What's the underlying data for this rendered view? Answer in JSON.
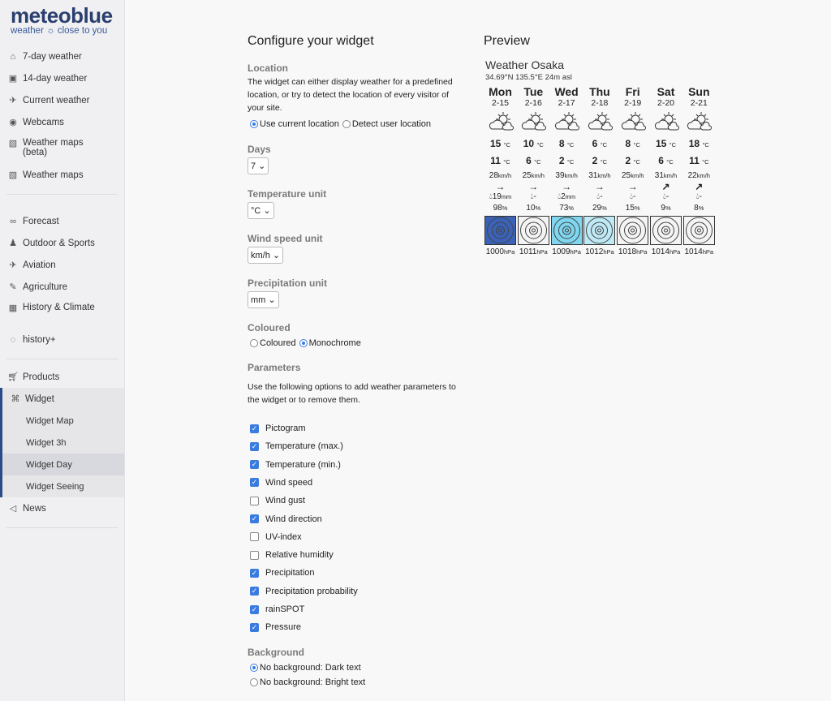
{
  "brand": {
    "name": "meteoblue",
    "tagline": "weather ☼ close to you"
  },
  "sidebar": {
    "group1": [
      {
        "label": "7-day weather",
        "icon": "home-icon",
        "glyph": "⌂"
      },
      {
        "label": "14-day weather",
        "icon": "calendar-icon",
        "glyph": "▣"
      },
      {
        "label": "Current weather",
        "icon": "satellite-icon",
        "glyph": "✈"
      },
      {
        "label": "Webcams",
        "icon": "webcam-icon",
        "glyph": "◉"
      },
      {
        "label": "Weather maps (beta)",
        "icon": "map-icon",
        "glyph": "▧"
      },
      {
        "label": "Weather maps",
        "icon": "map-icon",
        "glyph": "▧"
      }
    ],
    "group2": [
      {
        "label": "Forecast",
        "icon": "glasses-icon",
        "glyph": "∞"
      },
      {
        "label": "Outdoor & Sports",
        "icon": "hiker-icon",
        "glyph": "♟"
      },
      {
        "label": "Aviation",
        "icon": "plane-icon",
        "glyph": "✈"
      },
      {
        "label": "Agriculture",
        "icon": "pen-icon",
        "glyph": "✎"
      },
      {
        "label": "History & Climate",
        "icon": "chart-icon",
        "glyph": "▦"
      },
      {
        "label": "history+",
        "icon": "history-icon",
        "glyph": "◌"
      }
    ],
    "products": "Products",
    "widget": "Widget",
    "widget_sub": [
      "Widget Map",
      "Widget 3h",
      "Widget Day",
      "Widget Seeing"
    ],
    "active": "Widget Day",
    "news": "News"
  },
  "form": {
    "title": "Configure your widget",
    "location_label": "Location",
    "location_desc": "The widget can either display weather for a predefined location, or try to detect the location of every visitor of your site.",
    "loc_opt1": "Use current location",
    "loc_opt2": "Detect user location",
    "days_label": "Days",
    "days_value": "7",
    "temp_label": "Temperature unit",
    "temp_value": "°C",
    "wind_label": "Wind speed unit",
    "wind_value": "km/h",
    "precip_label": "Precipitation unit",
    "precip_value": "mm",
    "coloured_label": "Coloured",
    "col_opt1": "Coloured",
    "col_opt2": "Monochrome",
    "params_label": "Parameters",
    "params_desc": "Use the following options to add weather parameters to the widget or to remove them.",
    "params": [
      {
        "label": "Pictogram",
        "checked": true
      },
      {
        "label": "Temperature (max.)",
        "checked": true
      },
      {
        "label": "Temperature (min.)",
        "checked": true
      },
      {
        "label": "Wind speed",
        "checked": true
      },
      {
        "label": "Wind gust",
        "checked": false
      },
      {
        "label": "Wind direction",
        "checked": true
      },
      {
        "label": "UV-index",
        "checked": false
      },
      {
        "label": "Relative humidity",
        "checked": false
      },
      {
        "label": "Precipitation",
        "checked": true
      },
      {
        "label": "Precipitation probability",
        "checked": true
      },
      {
        "label": "rainSPOT",
        "checked": true
      },
      {
        "label": "Pressure",
        "checked": true
      }
    ],
    "bg_label": "Background",
    "bg_opt1": "No background: Dark text",
    "bg_opt2": "No background: Bright text"
  },
  "preview": {
    "title": "Preview",
    "widget_title": "Weather Osaka",
    "coords": "34.69°N 135.5°E 24m asl",
    "units": {
      "temp": "°C",
      "wind": "km/h",
      "precip": "mm",
      "prob": "%",
      "pressure": "hPa"
    },
    "days": [
      {
        "name": "Mon",
        "date": "2-15",
        "max": "15",
        "min": "11",
        "wind": "28",
        "dir": "→",
        "precip": "19",
        "prob": "98",
        "pressure": "1000",
        "rain": "#3a62b8"
      },
      {
        "name": "Tue",
        "date": "2-16",
        "max": "10",
        "min": "6",
        "wind": "25",
        "dir": "→",
        "precip": "-",
        "prob": "10",
        "pressure": "1011",
        "rain": "#f4f4f4"
      },
      {
        "name": "Wed",
        "date": "2-17",
        "max": "8",
        "min": "2",
        "wind": "39",
        "dir": "→",
        "precip": "2",
        "prob": "73",
        "pressure": "1009",
        "rain": "#7fd6ee"
      },
      {
        "name": "Thu",
        "date": "2-18",
        "max": "6",
        "min": "2",
        "wind": "31",
        "dir": "→",
        "precip": "-",
        "prob": "29",
        "pressure": "1012",
        "rain": "#bfeaf5"
      },
      {
        "name": "Fri",
        "date": "2-19",
        "max": "8",
        "min": "2",
        "wind": "25",
        "dir": "→",
        "precip": "-",
        "prob": "15",
        "pressure": "1018",
        "rain": "#f4f4f4"
      },
      {
        "name": "Sat",
        "date": "2-20",
        "max": "15",
        "min": "6",
        "wind": "31",
        "dir": "↗",
        "precip": "-",
        "prob": "9",
        "pressure": "1014",
        "rain": "#f4f4f4"
      },
      {
        "name": "Sun",
        "date": "2-21",
        "max": "18",
        "min": "11",
        "wind": "22",
        "dir": "↗",
        "precip": "-",
        "prob": "8",
        "pressure": "1014",
        "rain": "#f4f4f4"
      }
    ]
  }
}
